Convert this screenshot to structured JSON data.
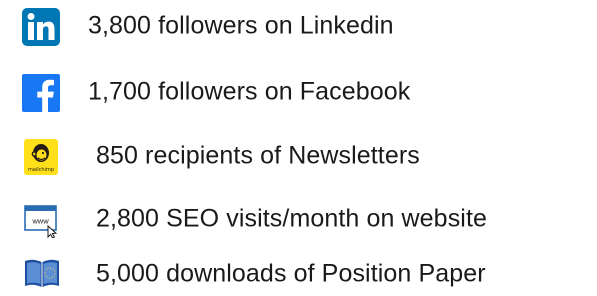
{
  "stats": [
    {
      "icon": "linkedin-icon",
      "text": "3,800 followers on Linkedin",
      "brand_color": "#0077B5"
    },
    {
      "icon": "facebook-icon",
      "text": "1,700 followers on Facebook",
      "brand_color": "#1877F2"
    },
    {
      "icon": "mailchimp-icon",
      "text": "850 recipients of Newsletters",
      "brand_color": "#FFE01B",
      "logo_text": "mailchimp"
    },
    {
      "icon": "website-icon",
      "text": "2,800 SEO visits/month on website",
      "brand_color": "#2a6db5",
      "logo_text": "www"
    },
    {
      "icon": "book-icon",
      "text": "5,000 downloads of Position Paper",
      "brand_color": "#1f4fa0"
    }
  ]
}
